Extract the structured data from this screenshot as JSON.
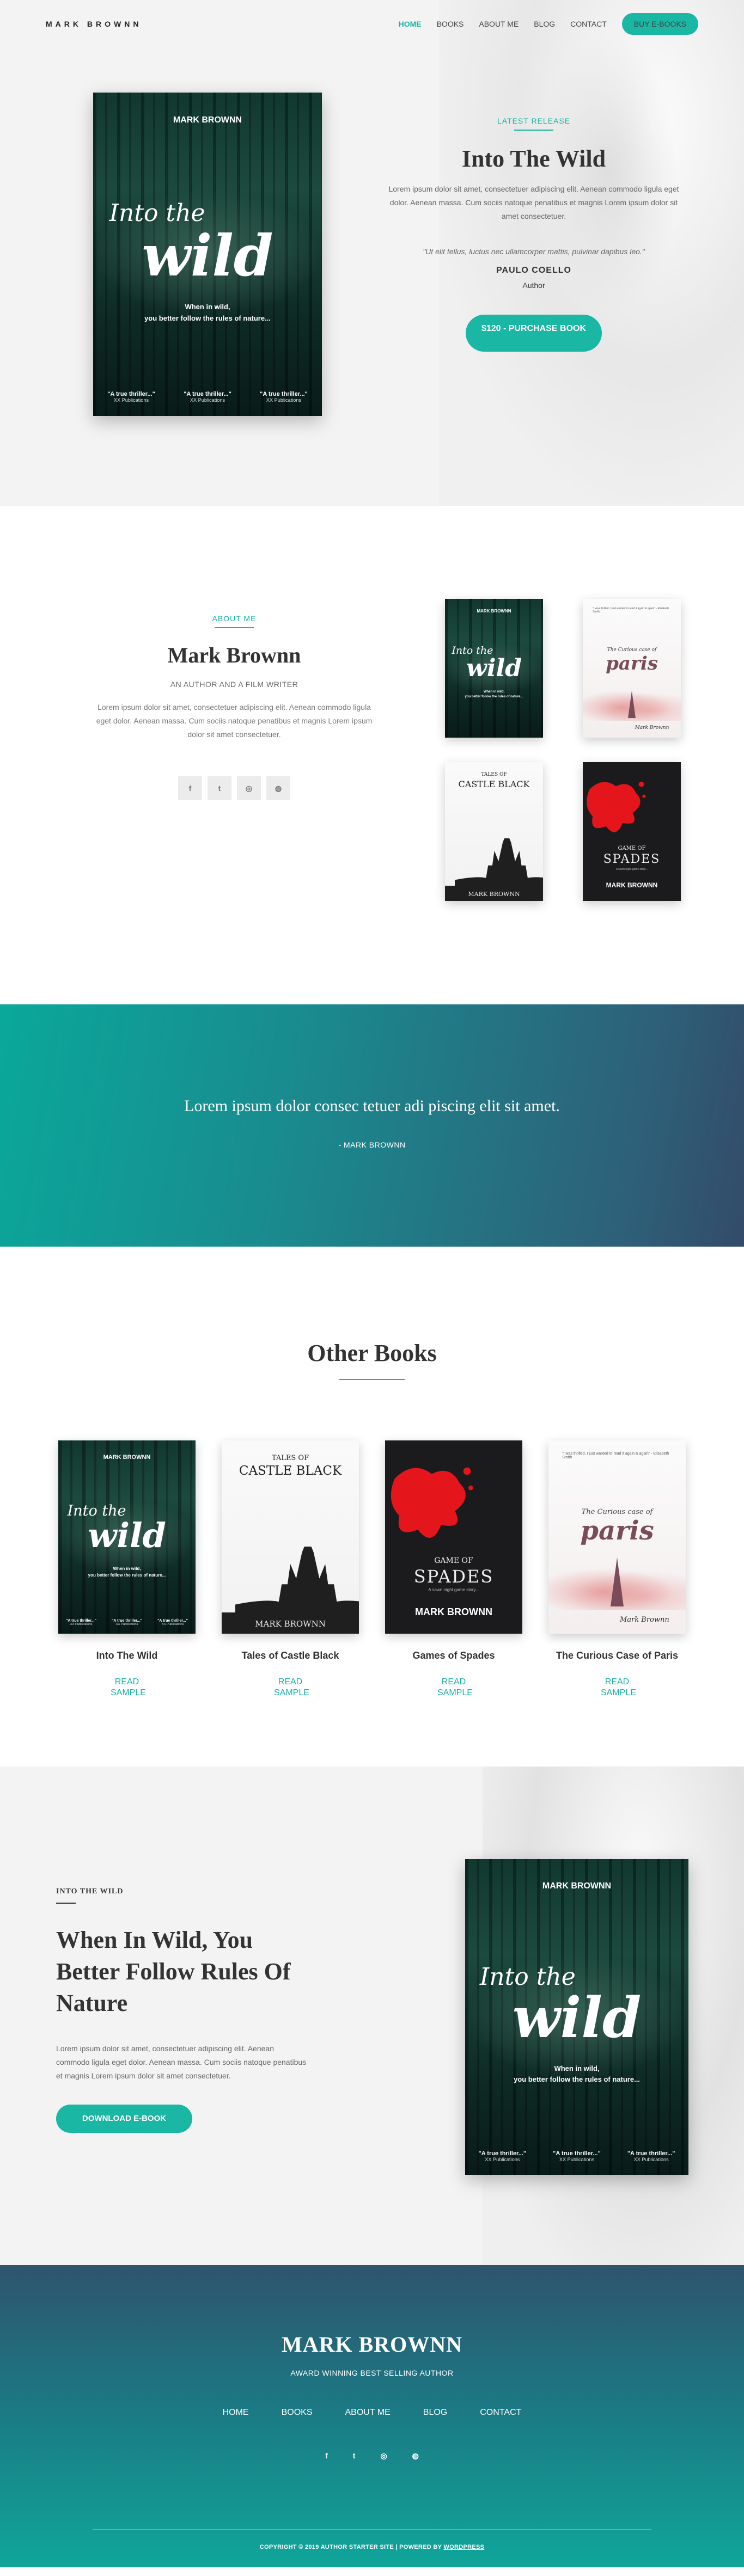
{
  "header": {
    "logo": "MARK BROWNN",
    "nav": [
      "HOME",
      "BOOKS",
      "ABOUT ME",
      "BLOG",
      "CONTACT"
    ],
    "cta": "BUY E-BOOKS",
    "accent": "#19b7a4"
  },
  "books": {
    "wild": {
      "author": "MARK BROWNN",
      "into": "Into the",
      "wild": "wild",
      "tagline_1": "When in wild,",
      "tagline_2": "you better follow the rules of nature...",
      "quote": "\"A true thriller...\"",
      "publisher": "XX Publications"
    },
    "paris": {
      "top_text": "\"I was thrilled, I just wanted to read it again & again\" - Elisabeth Smith",
      "curious": "The Curious case of",
      "word": "paris",
      "signature": "Mark Brownn"
    },
    "castle": {
      "tales": "TALES OF",
      "title": "CASTLE BLACK",
      "author": "MARK BROWNN"
    },
    "spades": {
      "game": "GAME OF",
      "title": "SPADES",
      "subtitle": "A sawn night game story...",
      "author": "MARK BROWNN"
    }
  },
  "hero": {
    "kicker": "LATEST RELEASE",
    "title": "Into The Wild",
    "body": "Lorem ipsum dolor sit amet, consectetuer adipiscing elit. Aenean commodo ligula eget dolor. Aenean massa. Cum sociis natoque penatibus et magnis Lorem ipsum dolor sit amet consectetuer.",
    "quote": "\"Ut elit tellus, luctus nec ullamcorper mattis, pulvinar dapibus leo.\"",
    "quote_author": "PAULO COELLO",
    "quote_role": "Author",
    "button": "$120 - PURCHASE BOOK"
  },
  "about": {
    "kicker": "ABOUT ME",
    "name": "Mark Brownn",
    "subtitle": "AN AUTHOR AND A FILM WRITER",
    "body": "Lorem ipsum dolor sit amet, consectetuer adipiscing elit. Aenean commodo ligula eget dolor. Aenean massa. Cum sociis natoque penatibus et magnis Lorem ipsum dolor sit amet consectetuer.",
    "social_icons": [
      "facebook-icon",
      "twitter-icon",
      "instagram-icon",
      "dribbble-icon"
    ],
    "social_glyphs": [
      "f",
      "t",
      "◎",
      "◍"
    ]
  },
  "quote_band": {
    "text": "Lorem ipsum dolor consec tetuer adi piscing elit sit amet.",
    "author": "- MARK BROWNN"
  },
  "other_books": {
    "title": "Other Books",
    "items": [
      {
        "title": "Into The Wild",
        "link": "READ SAMPLE"
      },
      {
        "title": "Tales of Castle Black",
        "link": "READ SAMPLE"
      },
      {
        "title": "Games of Spades",
        "link": "READ SAMPLE"
      },
      {
        "title": "The Curious Case of Paris",
        "link": "READ SAMPLE"
      }
    ]
  },
  "feature": {
    "kicker": "INTO THE WILD",
    "title": "When In Wild, You Better Follow Rules Of Nature",
    "body": "Lorem ipsum dolor sit amet, consectetuer adipiscing elit. Aenean commodo ligula eget dolor. Aenean massa. Cum sociis natoque penatibus et magnis Lorem ipsum dolor sit amet consectetuer.",
    "button": "DOWNLOAD E-BOOK"
  },
  "footer": {
    "name": "MARK BROWNN",
    "subtitle": "AWARD WINNING BEST SELLING AUTHOR",
    "nav": [
      "HOME",
      "BOOKS",
      "ABOUT ME",
      "BLOG",
      "CONTACT"
    ],
    "social_glyphs": [
      "f",
      "t",
      "◎",
      "◍"
    ],
    "copyright": "COPYRIGHT © 2019 AUTHOR STARTER SITE | POWERED BY",
    "copyright_link": "WORDPRESS"
  }
}
